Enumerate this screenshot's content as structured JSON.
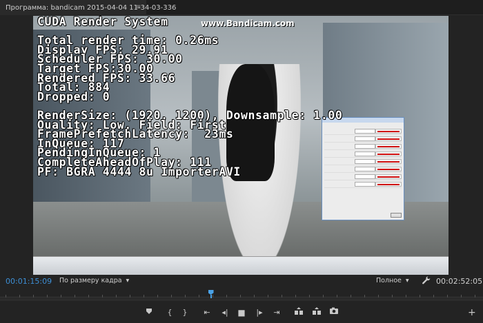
{
  "tab": {
    "label": "Программа: bandicam 2015-04-04 11-34-03-336",
    "menu_icon": "≡"
  },
  "video": {
    "watermark": "www.Bandicam.com",
    "overlay_lines": [
      "CUDA Render System",
      "",
      "Total render time: 0.26ms",
      "Display FPS: 29.91",
      "Scheduler FPS: 30.00",
      "Target FPS:30.00",
      "Rendered FPS: 33.66",
      "Total: 884",
      "Dropped: 0",
      "",
      "RenderSize: (1920, 1200), Downsample: 1.00",
      "Quality: Low, Field: First",
      "FramePrefetchLatency:  23ms",
      "InQueue: 117",
      "PendingInQueue: 1",
      "CompleteAheadOfPlay: 111",
      "PF: BGRA 4444 8u ImporterAVI"
    ]
  },
  "controls": {
    "timecode_current": "00:01:15:09",
    "fit": "По размеру кадра",
    "quality": "Полное",
    "timecode_duration": "00:02:52:05",
    "playhead_fraction": 0.435
  }
}
